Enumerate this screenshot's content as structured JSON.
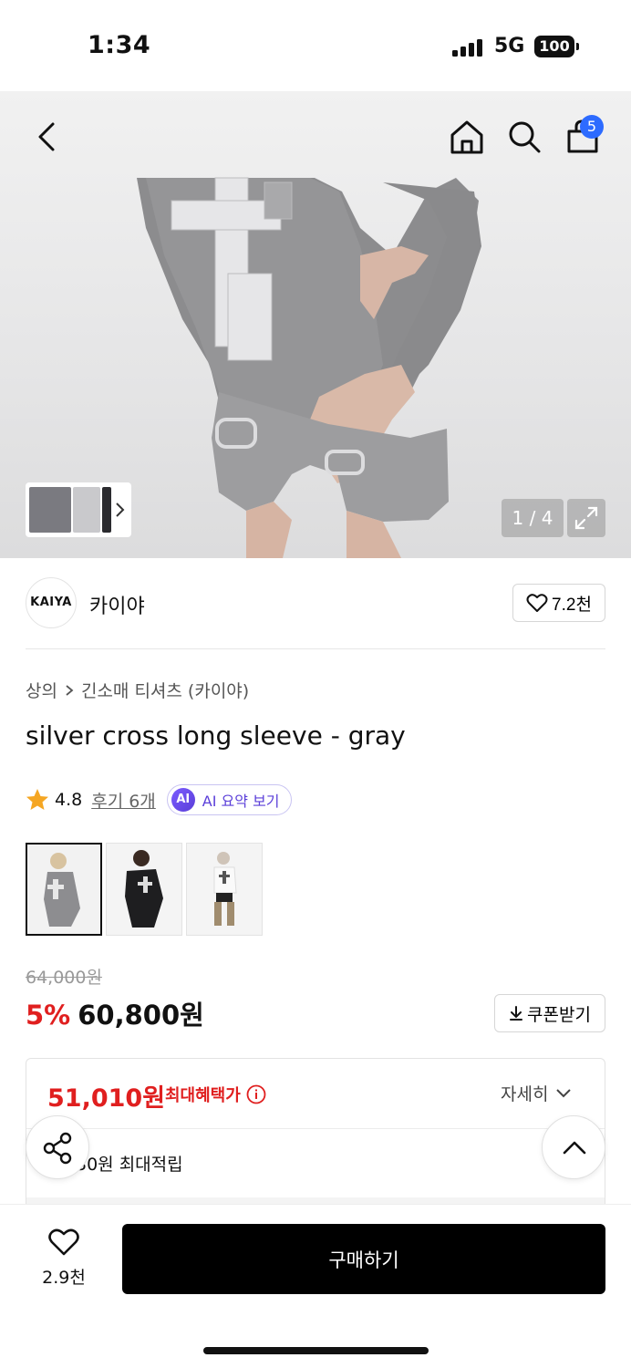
{
  "status_bar": {
    "time": "1:34",
    "network": "5G",
    "battery": "100"
  },
  "header": {
    "cart_count": "5"
  },
  "gallery": {
    "counter": "1 / 4"
  },
  "brand": {
    "logo_text": "KAIYA",
    "name": "카이야",
    "likes": "7.2천"
  },
  "breadcrumb": {
    "category": "상의",
    "subcategory": "긴소매 티셔츠 (카이야)"
  },
  "product": {
    "title": "silver cross long sleeve - gray",
    "rating": "4.8",
    "reviews": "후기 6개",
    "ai_summary": "AI 요약 보기",
    "ai_badge": "AI",
    "original_price": "64,000원",
    "discount": "5%",
    "price": "60,800원",
    "coupon_label": "쿠폰받기"
  },
  "benefit": {
    "max_price": "51,010원",
    "max_label": "최대혜택가",
    "detail_label": "자세히",
    "points": "30원 최대적립"
  },
  "bottom": {
    "wish_count": "2.9천",
    "buy_label": "구매하기"
  },
  "colors": {
    "accent_red": "#e01f1f",
    "badge_blue": "#2d6bff",
    "ai_purple": "#5b3fd9"
  }
}
